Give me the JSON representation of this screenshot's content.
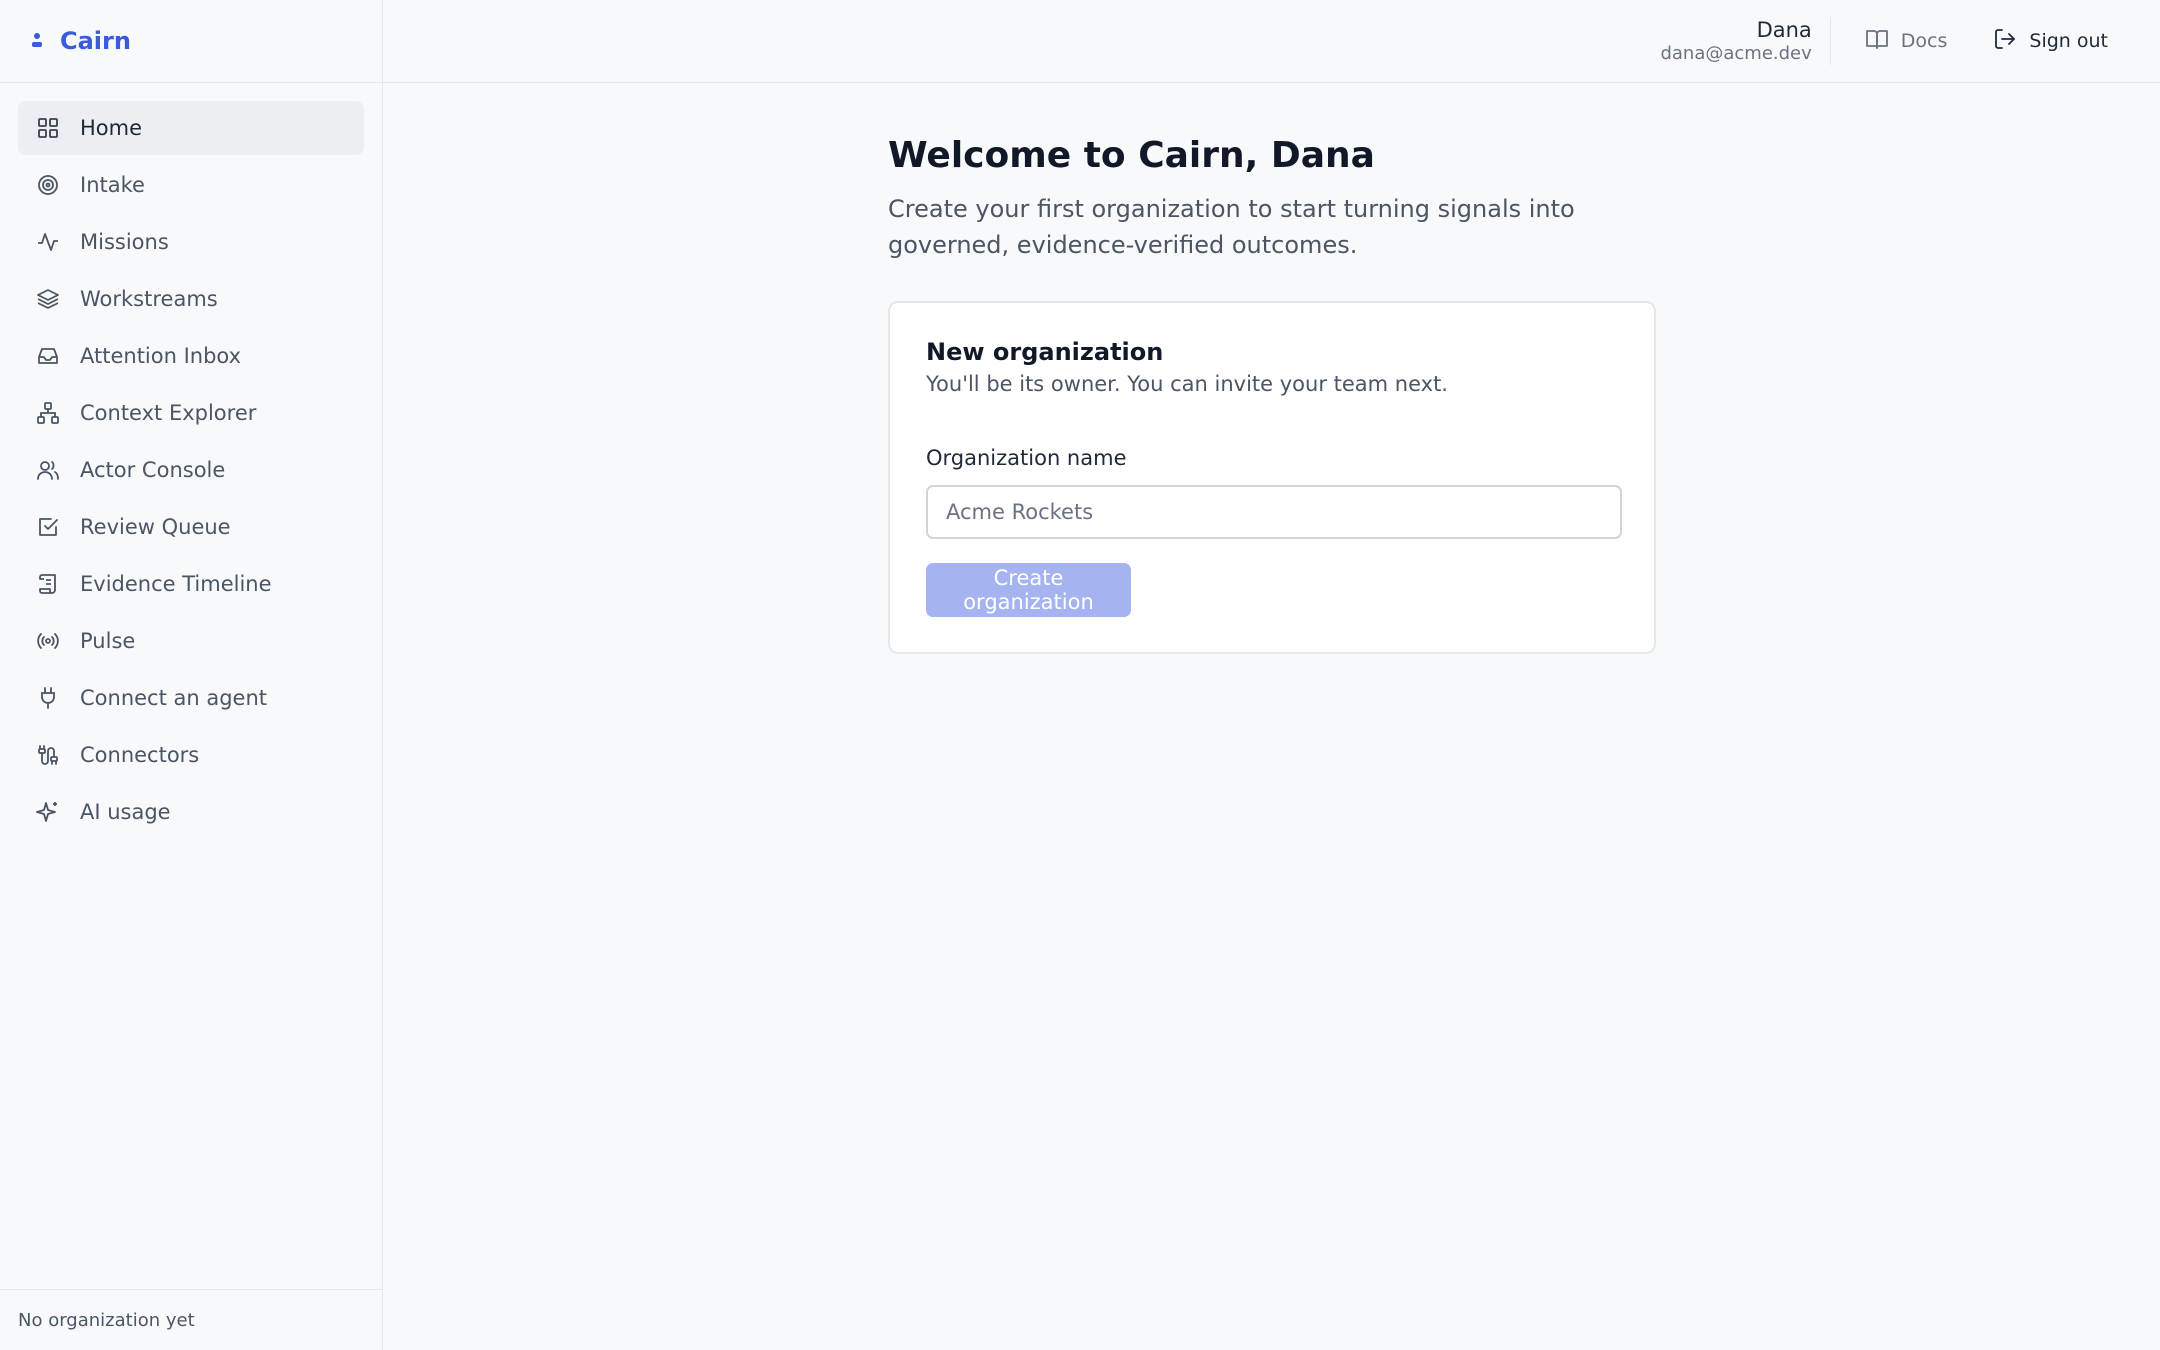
{
  "app": {
    "name": "Cairn",
    "brand_color": "#3b5bdb"
  },
  "sidebar": {
    "items": [
      {
        "label": "Home",
        "icon": "grid-icon",
        "active": true
      },
      {
        "label": "Intake",
        "icon": "target-icon"
      },
      {
        "label": "Missions",
        "icon": "activity-icon"
      },
      {
        "label": "Workstreams",
        "icon": "layers-icon"
      },
      {
        "label": "Attention Inbox",
        "icon": "inbox-icon"
      },
      {
        "label": "Context Explorer",
        "icon": "network-icon"
      },
      {
        "label": "Actor Console",
        "icon": "users-icon"
      },
      {
        "label": "Review Queue",
        "icon": "check-square-icon"
      },
      {
        "label": "Evidence Timeline",
        "icon": "scroll-icon"
      },
      {
        "label": "Pulse",
        "icon": "radio-icon"
      },
      {
        "label": "Connect an agent",
        "icon": "plug-icon"
      },
      {
        "label": "Connectors",
        "icon": "cable-icon"
      },
      {
        "label": "AI usage",
        "icon": "sparkles-icon"
      }
    ],
    "footer": "No organization yet"
  },
  "header": {
    "user_name": "Dana",
    "user_email": "dana@acme.dev",
    "docs_label": "Docs",
    "signout_label": "Sign out"
  },
  "main": {
    "title": "Welcome to Cairn, Dana",
    "subtitle": "Create your first organization to start turning signals into governed, evidence-verified outcomes.",
    "card": {
      "title": "New organization",
      "subtitle": "You'll be its owner. You can invite your team next.",
      "field_label": "Organization name",
      "field_placeholder": "Acme Rockets",
      "field_value": "",
      "button_label": "Create organization",
      "button_color": "#a5b4f0"
    }
  }
}
